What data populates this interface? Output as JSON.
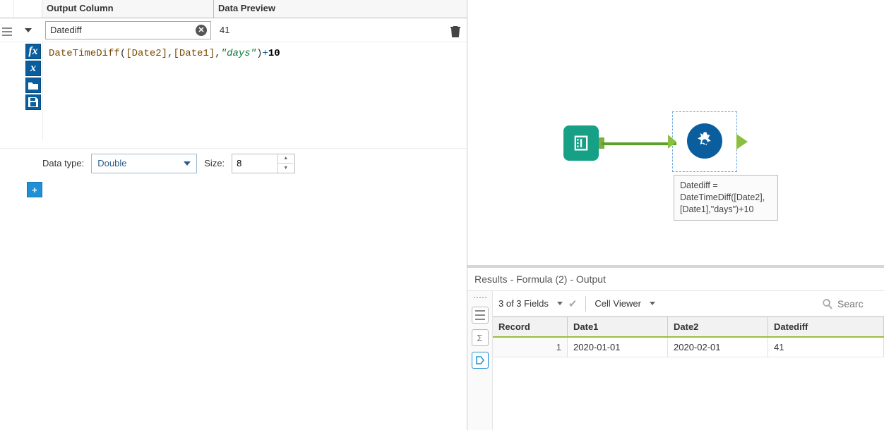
{
  "config": {
    "headers": {
      "output": "Output Column",
      "preview": "Data Preview"
    },
    "output_name": "Datediff",
    "preview_value": "41",
    "formula_tokens": {
      "fn": "DateTimeDiff",
      "lp": "(",
      "f1": "[Date2]",
      "c1": ",",
      "f2": "[Date1]",
      "c2": ",",
      "str": "\"days\"",
      "rp": ")",
      "op": "+",
      "num": "10"
    },
    "datatype_label": "Data type:",
    "datatype_value": "Double",
    "size_label": "Size:",
    "size_value": "8"
  },
  "canvas": {
    "annotation": "Datediff = DateTimeDiff([Date2],[Date1],\"days\")+10"
  },
  "results": {
    "title": "Results - Formula (2) - Output",
    "fields_summary": "3 of 3 Fields",
    "cell_viewer_label": "Cell Viewer",
    "search_placeholder": "Searc",
    "columns": {
      "rec": "Record",
      "c1": "Date1",
      "c2": "Date2",
      "c3": "Datediff"
    },
    "row1": {
      "rec": "1",
      "c1": "2020-01-01",
      "c2": "2020-02-01",
      "c3": "41"
    }
  }
}
